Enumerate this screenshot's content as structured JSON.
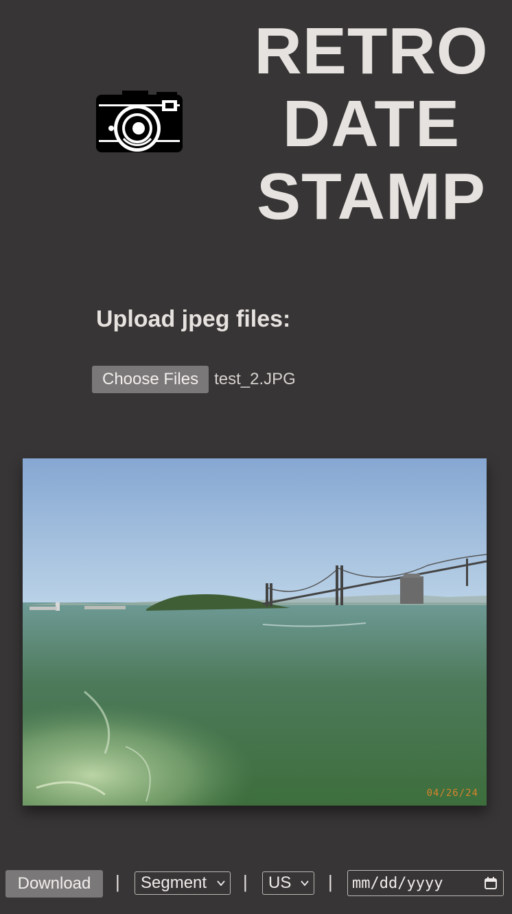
{
  "header": {
    "title_lines": [
      "RETRO",
      "DATE",
      "STAMP"
    ],
    "logo_icon": "camera-icon"
  },
  "upload": {
    "label": "Upload jpeg files:",
    "button_label": "Choose Files",
    "file_name": "test_2.JPG"
  },
  "preview": {
    "stamp_text": "04/26/24",
    "stamp_color": "#e8872a"
  },
  "toolbar": {
    "download_label": "Download",
    "separator": "|",
    "font_select_value": "Segment",
    "format_select_value": "US",
    "date_placeholder": "mm/dd/yyyy",
    "calendar_icon": "calendar-icon",
    "chevron_icon": "chevron-down-icon"
  },
  "colors": {
    "background": "#373535",
    "text": "#e6e2e0",
    "button_bg": "#7a7878"
  }
}
